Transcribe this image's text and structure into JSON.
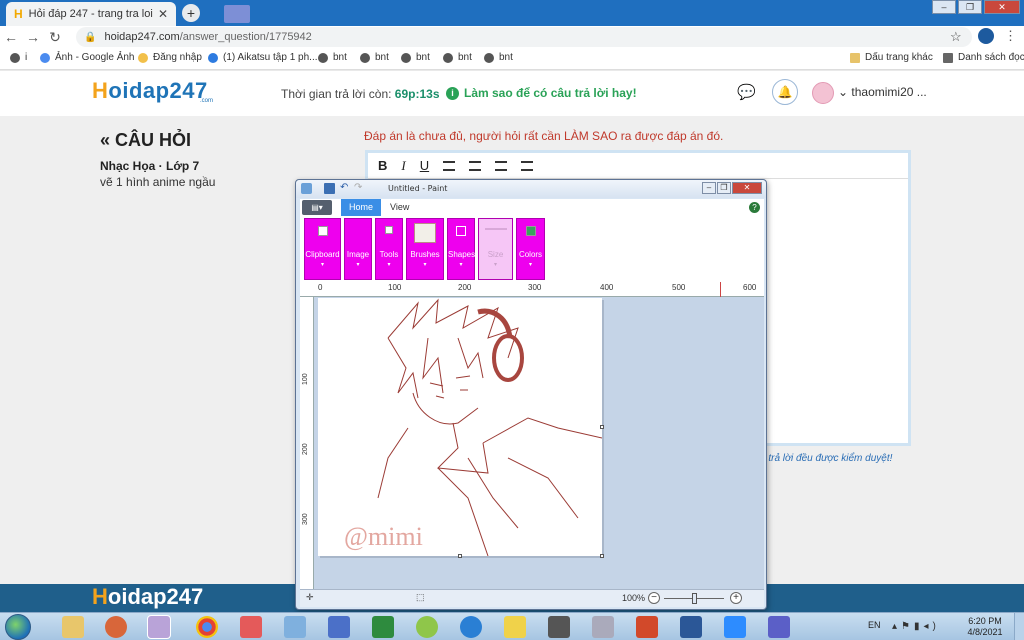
{
  "browser": {
    "tab_title": "Hỏi đáp 247 - trang tra loi",
    "tab_favicon": "H",
    "tab_close": "✕",
    "new_tab": "+",
    "url_domain": "hoidap247.com",
    "url_path": "/answer_question/1775942",
    "bookmarks": [
      {
        "label": "i",
        "icon": "apps-icon"
      },
      {
        "label": "Ảnh - Google Ảnh",
        "icon": "google-photos-icon"
      },
      {
        "label": "Đăng nhập",
        "icon": "login-icon"
      },
      {
        "label": "(1) Aikatsu tập 1 ph...",
        "icon": "video-icon"
      },
      {
        "label": "bnt",
        "icon": "web-icon"
      },
      {
        "label": "bnt",
        "icon": "web-icon"
      },
      {
        "label": "bnt",
        "icon": "web-icon"
      },
      {
        "label": "bnt",
        "icon": "web-icon"
      },
      {
        "label": "bnt",
        "icon": "web-icon"
      }
    ],
    "bookmarks_other": "Dấu trang khác",
    "reading_list": "Danh sách đọc"
  },
  "site": {
    "logo": "oidap247",
    "logo_h": "H",
    "logo_sub": ".com",
    "timer_label": "Thời gian trả lời còn:",
    "timer_value": "69p:13s",
    "howto_label": "Làm sao để có câu trả lời hay!",
    "username": "thaomimi20 ..."
  },
  "question": {
    "title": "CÂU HỎI",
    "subject": "Nhạc Họa · Lớp 7",
    "text": "vẽ 1 hình anime ngầu",
    "warning": "Đáp án là chưa đủ, người hỏi rất cần LÀM SAO ra được đáp án đó.",
    "toolbar": {
      "bold": "B",
      "italic": "I",
      "underline": "U"
    },
    "note": "u trả lời đều được kiểm duyệt!"
  },
  "paint": {
    "title": "Untitled - Paint",
    "tabs": {
      "home": "Home",
      "view": "View"
    },
    "groups": [
      "Clipboard",
      "Image",
      "Tools",
      "Brushes",
      "Shapes",
      "Size",
      "Colors"
    ],
    "ruler_h": [
      "0",
      "100",
      "200",
      "300",
      "400",
      "500",
      "600"
    ],
    "ruler_v": [
      "100",
      "200",
      "300"
    ],
    "watermark": "@mimi",
    "zoom": "100%",
    "drawing_color": "#9b3b35",
    "group_color": "#ee00ee"
  },
  "taskbar": {
    "language": "EN",
    "time": "6:20 PM",
    "date": "4/8/2021"
  }
}
